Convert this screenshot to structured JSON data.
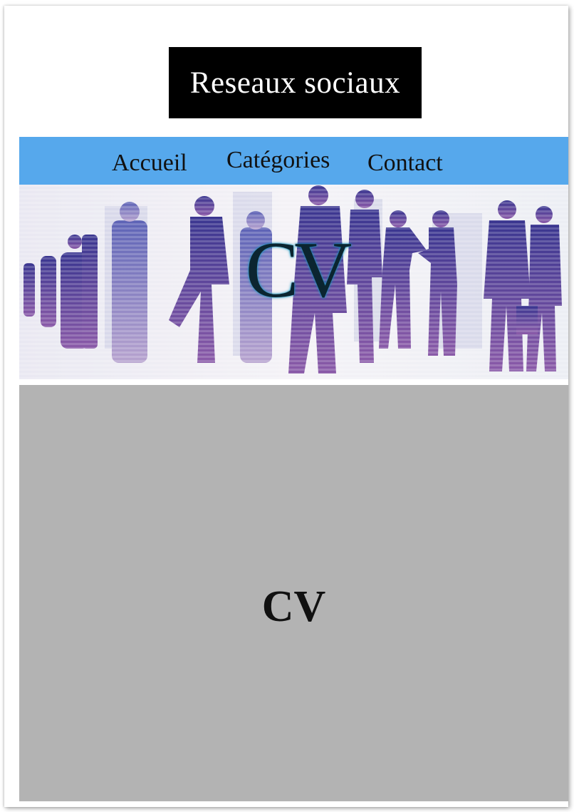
{
  "header": {
    "title": "Reseaux sociaux"
  },
  "nav": {
    "items": [
      {
        "label": "Accueil"
      },
      {
        "label": "Catégories"
      },
      {
        "label": "Contact"
      }
    ]
  },
  "banner": {
    "text": "CV"
  },
  "main": {
    "text": "CV"
  },
  "colors": {
    "title_bg": "#000000",
    "title_text": "#ffffff",
    "nav_bg": "#56a8ec",
    "banner_text": "#0b2530",
    "banner_glow": "#1496be",
    "content_bg": "#b3b3b3",
    "silhouette_dark": "#2c2a78",
    "silhouette_light": "#6a6fb8"
  }
}
